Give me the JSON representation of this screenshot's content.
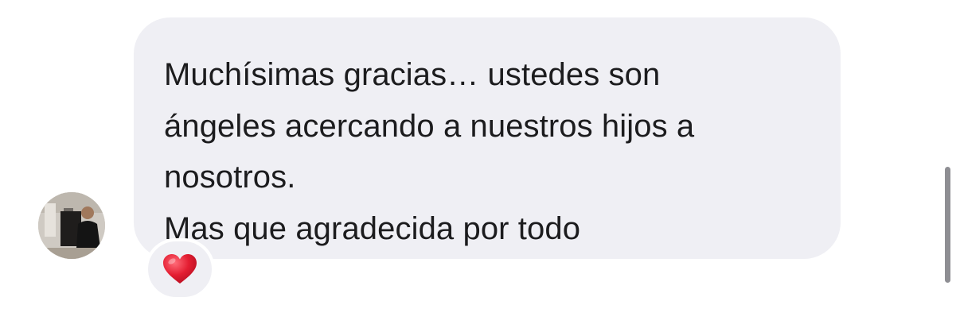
{
  "message": {
    "lines": [
      "Muchísimas gracias… ustedes son",
      "ángeles acercando a nuestros hijos a",
      "nosotros.",
      "Mas que agradecida por todo"
    ]
  },
  "reaction": {
    "icon": "red-heart-icon",
    "color": "#e0182d"
  },
  "avatar": {
    "icon": "user-avatar"
  },
  "colors": {
    "bubble": "#efeff4",
    "text": "#1c1c1e",
    "background": "#ffffff",
    "scrollbar": "#8e8e93"
  }
}
